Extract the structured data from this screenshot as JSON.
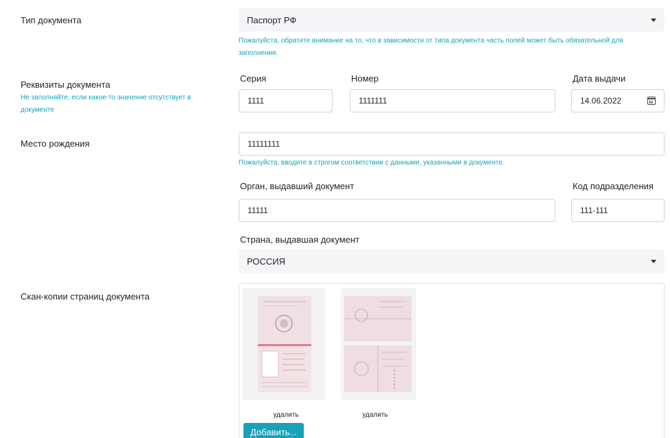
{
  "doc_type": {
    "label": "Тип документа",
    "value": "Паспорт РФ",
    "help": "Пожалуйста, обратите внимание на то, что в зависимости от типа документа часть полей может быть обязательной для заполнения."
  },
  "requisites": {
    "label": "Реквизиты документа",
    "help": "Не заполняйте, если какое-то значение отсутствует в документе",
    "series_label": "Серия",
    "series_value": "1111",
    "number_label": "Номер",
    "number_value": "1111111",
    "date_label": "Дата выдачи",
    "date_value": "14.06.2022"
  },
  "birthplace": {
    "label": "Место рождения",
    "value": "11111111",
    "help": "Пожалуйста, вводите в строгом соответствии с данными, указанными в документе."
  },
  "issuer": {
    "org_label": "Орган, выдавший документ",
    "org_value": "11111",
    "code_label": "Код подразделения",
    "code_value": "111-111"
  },
  "country": {
    "label": "Страна, выдавшая документ",
    "value": "РОССИЯ"
  },
  "scans": {
    "label": "Скан-копии страниц документа",
    "items": [
      {
        "delete_label": "удалить"
      },
      {
        "delete_label": "удалить"
      }
    ],
    "add_label": "Добавить..."
  },
  "icons": {
    "dropdown": "caret-down-icon",
    "calendar": "calendar-icon"
  }
}
